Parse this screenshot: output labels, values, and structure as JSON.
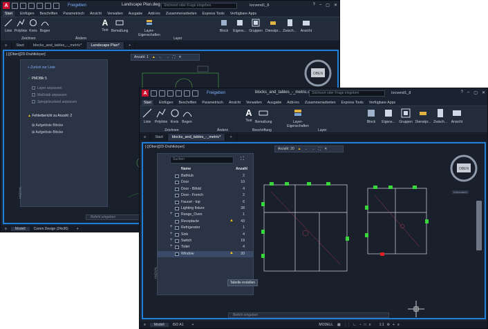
{
  "back_window": {
    "app_letter": "A",
    "share": "Freigeben",
    "title": "Landscape Plan.dwg",
    "search_placeholder": "Stichwort oder Frage eingeben",
    "user": "Iocvend1_8",
    "menu": [
      "Start",
      "Einfügen",
      "Beschriften",
      "Parametrisch",
      "Ansicht",
      "Verwalten",
      "Ausgabe",
      "Add-ins",
      "Zusammenarbeiten",
      "Express Tools",
      "Verfügbare Apps"
    ],
    "ribbon_tools": [
      "Linie",
      "Polylinie",
      "Kreis",
      "Bogen",
      "Text",
      "Bemaßung",
      "Layer-Eigenschaften",
      "Block",
      "Eigens...",
      "Gruppen",
      "Dienstpr...",
      "Zwisch...",
      "Ansicht"
    ],
    "ribbon_groups": [
      "Zeichnen",
      "Ändern",
      "Layer"
    ],
    "file_tabs": [
      "Start",
      "blocks_and_tables_-_metric*",
      "Landscape Plan*"
    ],
    "viewport_label": "[-][Oben][2D-Drahtkörper]",
    "float_bar": "Anzahl: 1",
    "panel": {
      "back": "« Zurück zur Liste",
      "section1": "PMDBlk 5",
      "items": [
        "Layer anpassen",
        "Maßstab anpassen",
        "Spiegelzustand anpassen"
      ],
      "section2": "Fehlerbericht zu Anzahl: 2",
      "links": [
        "Aufgelöste Blöcke",
        "Aufgelöste Blöcke"
      ],
      "side_label": "ANZAHL"
    },
    "cube_label": "OBEN",
    "command_placeholder": "Befehl eingeben",
    "layout_tabs": [
      "Modell",
      "Comm Design (24x36)"
    ]
  },
  "front_window": {
    "app_letter": "A",
    "share": "Freigeben",
    "title": "blocks_and_tables_-_metric.dwg",
    "search_placeholder": "Stichwort oder Frage eingeben",
    "user": "Iocvend1_8",
    "menu": [
      "Start",
      "Einfügen",
      "Beschriften",
      "Parametrisch",
      "Ansicht",
      "Verwalten",
      "Ausgabe",
      "Add-ins",
      "Zusammenarbeiten",
      "Express Tools",
      "Verfügbare Apps"
    ],
    "ribbon_tools": [
      "Linie",
      "Polylinie",
      "Kreis",
      "Bogen",
      "Text",
      "Bemaßung",
      "Layer-Eigenschaften",
      "Block",
      "Eigens...",
      "Gruppen",
      "Dienstpr...",
      "Zwisch...",
      "Ansicht"
    ],
    "ribbon_groups": [
      "Zeichnen",
      "Ändern",
      "Beschriftung",
      "Layer"
    ],
    "file_tabs": [
      "Start",
      "blocks_and_tables_-_metric*"
    ],
    "viewport_label": "[-][Oben][2D-Drahtkörper]",
    "float_bar": "Anzahl: 20",
    "panel": {
      "search_placeholder": "Suchen",
      "col_name": "Name",
      "col_count": "Anzahl",
      "rows": [
        {
          "name": "Bathtub",
          "count": "2",
          "plus": false,
          "warn": false
        },
        {
          "name": "Door",
          "count": "10",
          "plus": false,
          "warn": false
        },
        {
          "name": "Door - Bifold",
          "count": "4",
          "plus": false,
          "warn": false
        },
        {
          "name": "Door - French",
          "count": "2",
          "plus": false,
          "warn": false
        },
        {
          "name": "Faucet - top",
          "count": "6",
          "plus": false,
          "warn": false
        },
        {
          "name": "Lighting fixture",
          "count": "28",
          "plus": false,
          "warn": false
        },
        {
          "name": "Range_Oven",
          "count": "1",
          "plus": true,
          "warn": false
        },
        {
          "name": "Receptacle",
          "count": "43",
          "plus": false,
          "warn": true
        },
        {
          "name": "Refrigerator",
          "count": "1",
          "plus": true,
          "warn": false
        },
        {
          "name": "Sink",
          "count": "4",
          "plus": true,
          "warn": false
        },
        {
          "name": "Switch",
          "count": "19",
          "plus": true,
          "warn": false
        },
        {
          "name": "Toilet",
          "count": "4",
          "plus": true,
          "warn": false
        },
        {
          "name": "Window",
          "count": "20",
          "plus": false,
          "warn": true
        }
      ],
      "create_table": "Tabelle erstellen",
      "side_label": "ANZAHL"
    },
    "cube_label": "OBEN",
    "cube_sub": "Unbenannt",
    "command_placeholder": "Befehl eingeben",
    "layout_tabs": [
      "Modell",
      "ISO A1"
    ],
    "status_model": "MODELL",
    "status_scale": "1:1"
  }
}
